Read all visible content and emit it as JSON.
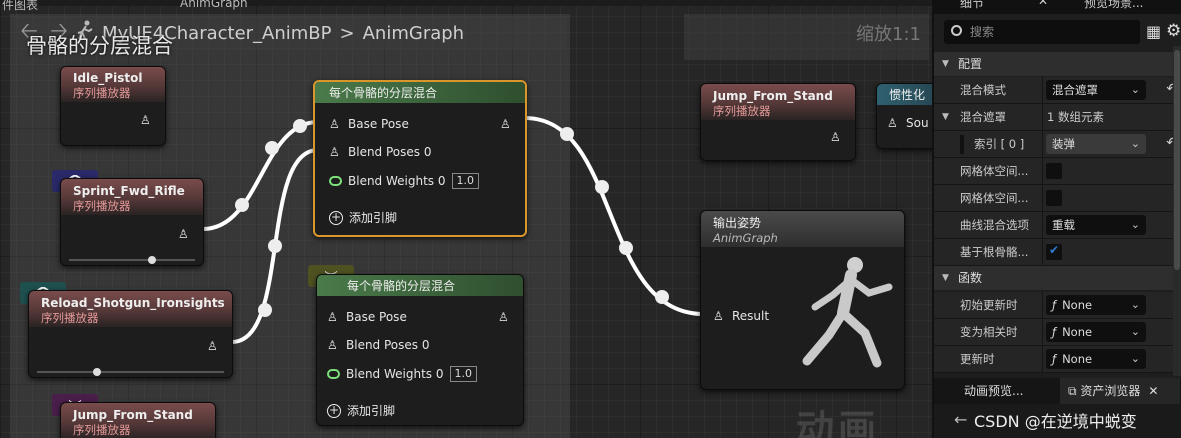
{
  "window": {
    "tab_left": "件图表",
    "tab_anim": "AnimGraph"
  },
  "breadcrumb": {
    "path": "MyUE4Character_AnimBP",
    "separator": ">",
    "current": "AnimGraph"
  },
  "comment_title": "骨骼的分层混合",
  "zoom_label": "缩放1:1",
  "watermark": "动画",
  "nodes": {
    "idle_pistol": {
      "title": "Idle_Pistol",
      "subtitle": "序列播放器"
    },
    "sprint_fwd_rifle": {
      "title": "Sprint_Fwd_Rifle",
      "subtitle": "序列播放器",
      "slider_fraction": 0.63
    },
    "reload_shotgun": {
      "title": "Reload_Shotgun_Ironsights",
      "subtitle": "序列播放器",
      "slider_fraction": 0.3
    },
    "jump_from_stand_left": {
      "title": "Jump_From_Stand",
      "subtitle": "序列播放器"
    },
    "blend1": {
      "title": "每个骨骼的分层混合",
      "pin_base": "Base Pose",
      "pin_blend": "Blend Poses 0",
      "pin_weights": "Blend Weights 0",
      "weights_value": "1.0",
      "add_pin": "添加引脚"
    },
    "blend2": {
      "title": "每个骨骼的分层混合",
      "pin_base": "Base Pose",
      "pin_blend": "Blend Poses 0",
      "pin_weights": "Blend Weights 0",
      "weights_value": "1.0",
      "add_pin": "添加引脚"
    },
    "jump_from_stand_right": {
      "title": "Jump_From_Stand",
      "subtitle": "序列播放器"
    },
    "inertia": {
      "title": "惯性化",
      "pin_source": "Sou"
    },
    "output_pose": {
      "title": "输出姿势",
      "subtitle": "AnimGraph",
      "pin_result": "Result"
    }
  },
  "panel": {
    "tab_details": "细节",
    "tab_preview": "预览场景...",
    "search_placeholder": "搜索",
    "section_config": "配置",
    "section_functions": "函数",
    "rows": {
      "blend_mode_label": "混合模式",
      "blend_mode_value": "混合遮罩",
      "blend_mask_label": "混合遮罩",
      "blend_mask_value": "1 数组元素",
      "index_label": "索引 [ 0 ]",
      "index_value": "装弹",
      "mesh_space1_label": "网格体空间...",
      "mesh_space2_label": "网格体空间...",
      "curve_blend_label": "曲线混合选项",
      "curve_blend_value": "重载",
      "root_bone_label": "基于根骨骼...",
      "init_update_label": "初始更新时",
      "become_relevant_label": "变为相关时",
      "on_update_label": "更新时",
      "none_value": "None"
    },
    "bottom_tab_anim_preview": "动画预览...",
    "bottom_tab_asset_browser": "资产浏览器",
    "footer_text": "CSDN @在逆境中蜕变"
  },
  "colors": {
    "selected_outline": "#d9962a",
    "sequence_header": "#7a4c4c",
    "blend_header": "#4a7a4a",
    "checkbox_check": "#2f7bd6"
  }
}
